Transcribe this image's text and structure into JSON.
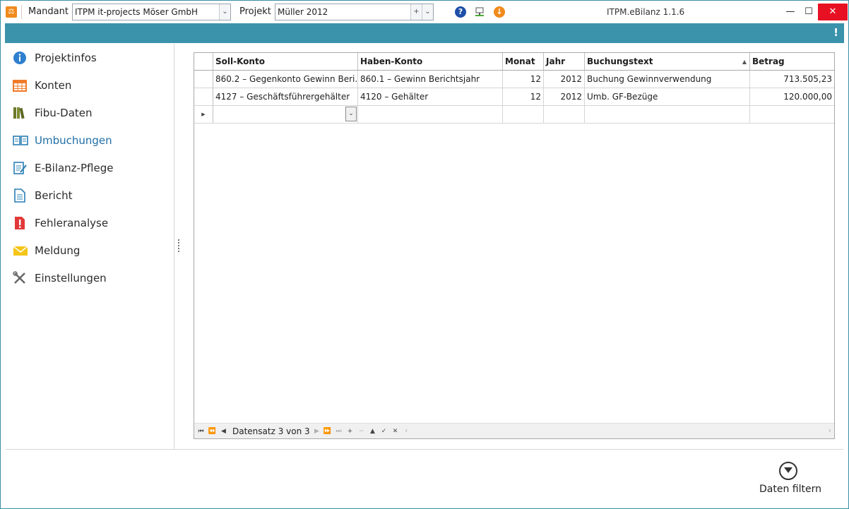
{
  "titlebar": {
    "mandant_label": "Mandant",
    "mandant_value": "ITPM it-projects Möser GmbH",
    "projekt_label": "Projekt",
    "projekt_value": "Müller 2012",
    "app_title": "ITPM.eBilanz 1.1.6",
    "minimize": "—",
    "maximize": "☐",
    "close": "✕"
  },
  "infobar": {
    "warning": "!"
  },
  "sidebar": {
    "items": [
      {
        "label": "Projektinfos",
        "icon": "info-icon"
      },
      {
        "label": "Konten",
        "icon": "table-icon"
      },
      {
        "label": "Fibu-Daten",
        "icon": "books-icon"
      },
      {
        "label": "Umbuchungen",
        "icon": "open-book-icon",
        "active": true
      },
      {
        "label": "E-Bilanz-Pflege",
        "icon": "edit-document-icon"
      },
      {
        "label": "Bericht",
        "icon": "document-icon"
      },
      {
        "label": "Fehleranalyse",
        "icon": "error-document-icon"
      },
      {
        "label": "Meldung",
        "icon": "envelope-icon"
      },
      {
        "label": "Einstellungen",
        "icon": "tools-icon"
      }
    ]
  },
  "grid": {
    "columns": [
      "Soll-Konto",
      "Haben-Konto",
      "Monat",
      "Jahr",
      "Buchungstext",
      "Betrag"
    ],
    "rows": [
      [
        "860.2 – Gegenkonto Gewinn Beri...",
        "860.1 – Gewinn Berichtsjahr",
        "12",
        "2012",
        "Buchung Gewinnverwendung",
        "713.505,23"
      ],
      [
        "4127 – Geschäftsführergehälter",
        "4120 – Gehälter",
        "12",
        "2012",
        "Umb. GF-Bezüge",
        "120.000,00"
      ]
    ],
    "navigator_text": "Datensatz 3 von 3"
  },
  "footer": {
    "filter_label": "Daten filtern"
  },
  "colors": {
    "accent": "#3a93aa",
    "active_nav": "#1f6ea6",
    "close": "#e81123"
  }
}
